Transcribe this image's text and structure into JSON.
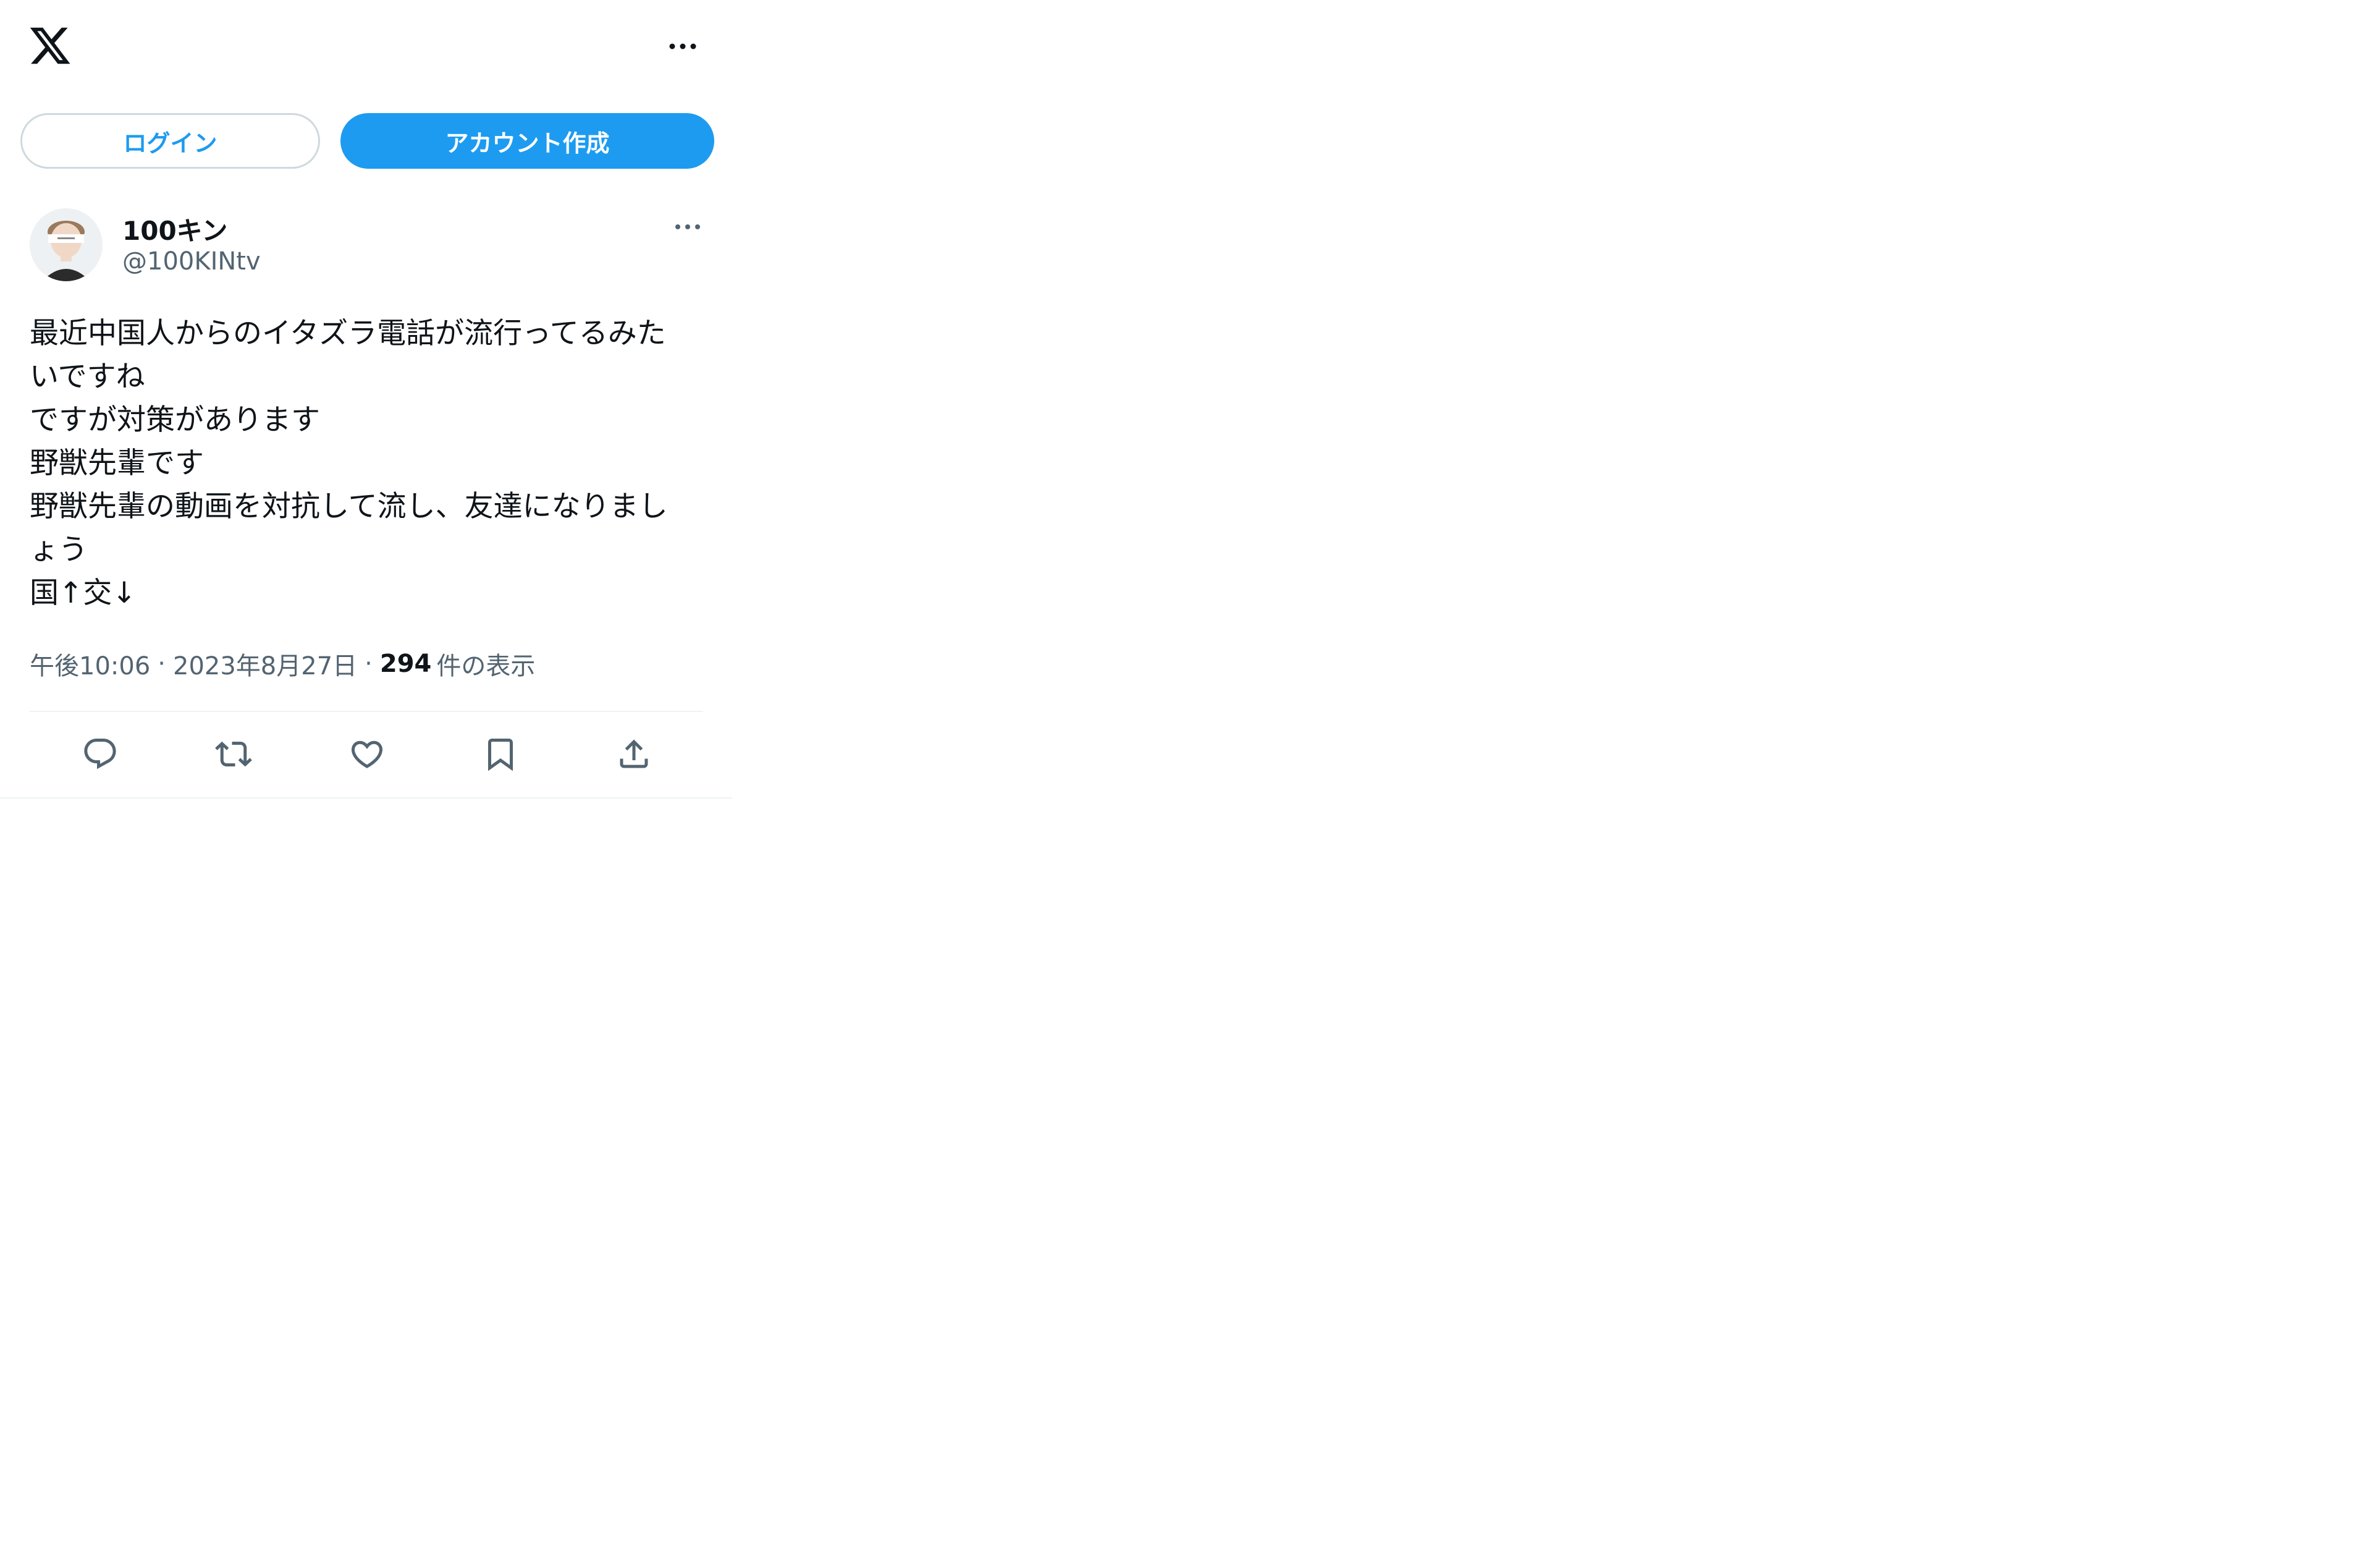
{
  "header": {
    "logo_icon": "x-logo-icon",
    "more_icon": "more-horizontal-icon"
  },
  "auth": {
    "login_label": "ログイン",
    "signup_label": "アカウント作成",
    "accent_color": "#1d9bf0"
  },
  "tweet": {
    "author_name": "100キン",
    "author_handle": "@100KINtv",
    "text_lines": [
      "最近中国人からのイタズラ電話が流行ってるみた",
      "いですね",
      "ですが対策があります",
      "野獣先輩です",
      "野獣先輩の動画を対抗して流し、友達になりまし",
      "ょう",
      "国↑交↓"
    ],
    "time": "午後10:06",
    "date": "2023年8月27日",
    "separator": "·",
    "view_count": "294",
    "view_label": "件の表示"
  },
  "actions": {
    "reply_icon": "reply-icon",
    "retweet_icon": "retweet-icon",
    "like_icon": "heart-icon",
    "bookmark_icon": "bookmark-icon",
    "share_icon": "share-icon"
  },
  "colors": {
    "text_primary": "#0f1419",
    "text_secondary": "#536471",
    "border": "#cfd9de"
  }
}
